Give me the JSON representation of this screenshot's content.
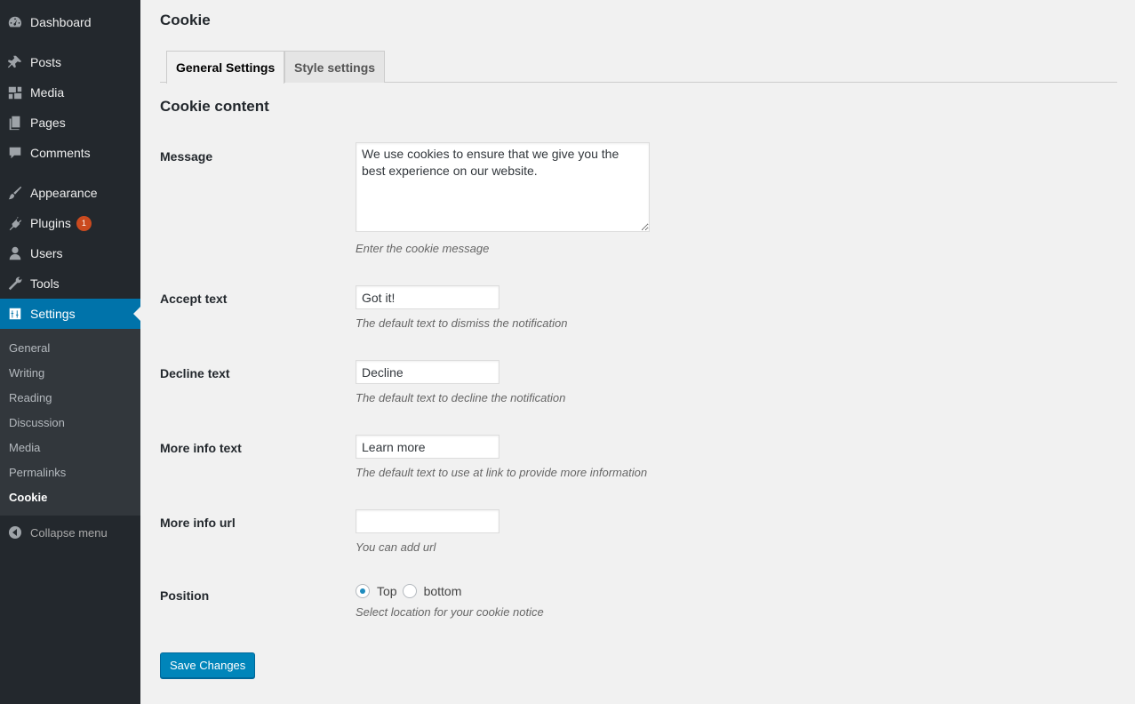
{
  "sidebar": {
    "items": [
      {
        "label": "Dashboard",
        "icon": "dashboard-icon"
      },
      {
        "label": "Posts",
        "icon": "pin-icon"
      },
      {
        "label": "Media",
        "icon": "media-icon"
      },
      {
        "label": "Pages",
        "icon": "pages-icon"
      },
      {
        "label": "Comments",
        "icon": "comment-icon"
      },
      {
        "label": "Appearance",
        "icon": "brush-icon"
      },
      {
        "label": "Plugins",
        "icon": "plugin-icon",
        "badge": "1"
      },
      {
        "label": "Users",
        "icon": "user-icon"
      },
      {
        "label": "Tools",
        "icon": "wrench-icon"
      },
      {
        "label": "Settings",
        "icon": "settings-icon",
        "active": true
      }
    ],
    "submenu": [
      "General",
      "Writing",
      "Reading",
      "Discussion",
      "Media",
      "Permalinks",
      "Cookie"
    ],
    "submenu_current": "Cookie",
    "collapse_label": "Collapse menu"
  },
  "main": {
    "page_title": "Cookie",
    "tabs": [
      {
        "label": "General Settings",
        "active": true
      },
      {
        "label": "Style settings",
        "active": false
      }
    ],
    "section_title": "Cookie content",
    "fields": {
      "message": {
        "label": "Message",
        "value": "We use cookies to ensure that we give you the best experience on our website.",
        "description": "Enter the cookie message"
      },
      "accept": {
        "label": "Accept text",
        "value": "Got it!",
        "description": "The default text to dismiss the notification"
      },
      "decline": {
        "label": "Decline text",
        "value": "Decline",
        "description": "The default text to decline the notification"
      },
      "more_info": {
        "label": "More info text",
        "value": "Learn more",
        "description": "The default text to use at link to provide more information"
      },
      "more_url": {
        "label": "More info url",
        "value": "",
        "description": "You can add url"
      },
      "position": {
        "label": "Position",
        "options": [
          "Top",
          "bottom"
        ],
        "selected": "Top",
        "description": "Select location for your cookie notice"
      }
    },
    "save_label": "Save Changes"
  },
  "colors": {
    "sidebar_bg": "#23282d",
    "submenu_bg": "#32373c",
    "accent": "#0073aa",
    "button": "#0085ba",
    "badge": "#ca4a1f"
  }
}
